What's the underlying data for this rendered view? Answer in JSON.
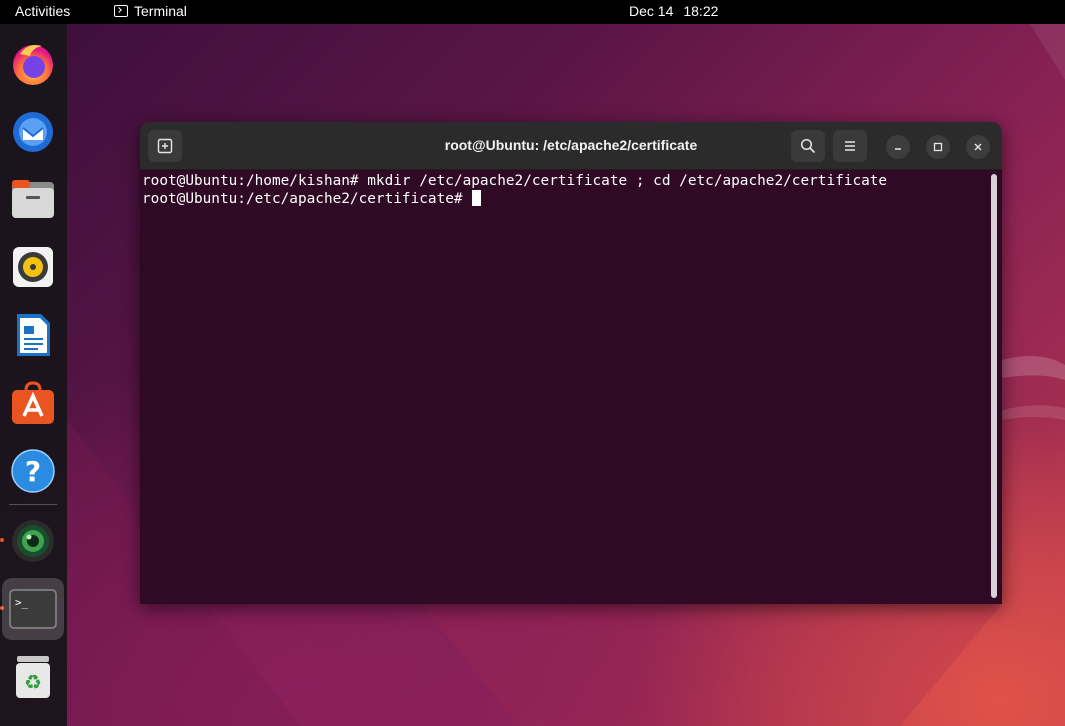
{
  "topbar": {
    "activities": "Activities",
    "app_name": "Terminal",
    "date": "Dec 14",
    "time": "18:22"
  },
  "dock": {
    "items": [
      {
        "name": "firefox",
        "icon": "firefox-icon"
      },
      {
        "name": "thunderbird",
        "icon": "thunderbird-icon"
      },
      {
        "name": "files",
        "icon": "files-icon"
      },
      {
        "name": "rhythmbox",
        "icon": "rhythmbox-icon"
      },
      {
        "name": "libreoffice-writer",
        "icon": "writer-icon"
      },
      {
        "name": "ubuntu-software",
        "icon": "software-icon"
      },
      {
        "name": "help",
        "icon": "help-icon"
      },
      {
        "name": "camera",
        "icon": "camera-icon",
        "running": true
      },
      {
        "name": "terminal",
        "icon": "terminal-icon",
        "running": true,
        "active": true
      },
      {
        "name": "trash",
        "icon": "trash-icon"
      }
    ]
  },
  "terminal": {
    "title": "root@Ubuntu: /etc/apache2/certificate",
    "lines": [
      "root@Ubuntu:/home/kishan# mkdir /etc/apache2/certificate ; cd /etc/apache2/certificate",
      "root@Ubuntu:/etc/apache2/certificate# "
    ]
  },
  "colors": {
    "terminal_bg": "#300a24",
    "titlebar_bg": "#2b2b2b",
    "accent": "#e95420"
  }
}
